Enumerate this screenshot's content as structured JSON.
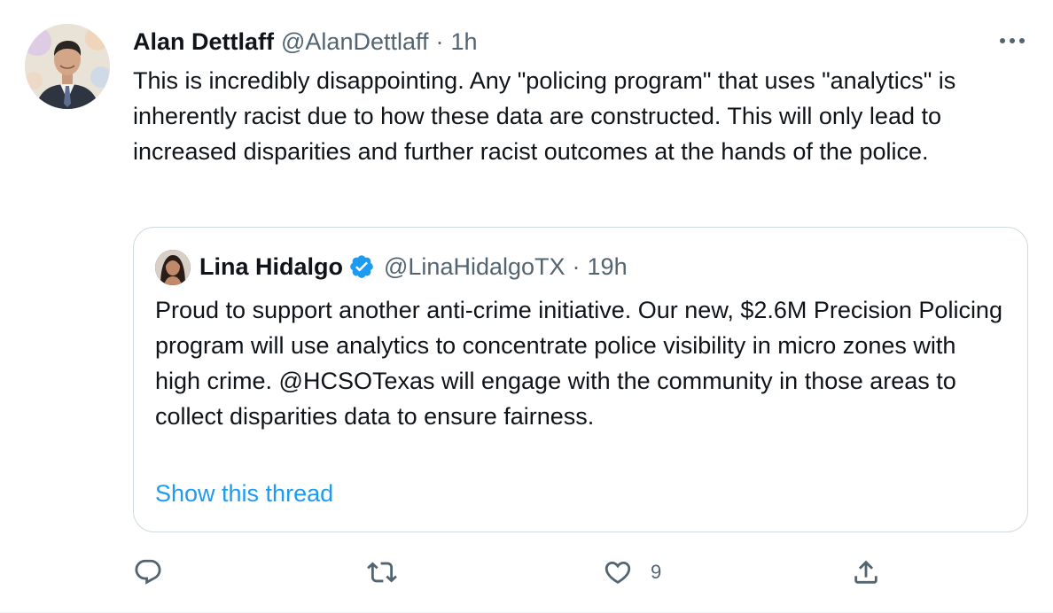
{
  "tweet": {
    "author_name": "Alan Dettlaff",
    "author_handle": "@AlanDettlaff",
    "separator": "·",
    "time": "1h",
    "text": "This is incredibly disappointing. Any \"policing program\" that uses \"analytics\" is inherently racist due to how these data are constructed. This will only lead to increased disparities and further racist outcomes at the hands of the police."
  },
  "quote": {
    "author_name": "Lina Hidalgo",
    "author_handle": "@LinaHidalgoTX",
    "separator": "·",
    "time": "19h",
    "verified": true,
    "text": "Proud to support another anti-crime initiative. Our new, $2.6M Precision Policing program will use analytics to concentrate police visibility in micro zones with high crime. @HCSOTexas will engage with the community in those areas to collect disparities data to ensure fairness.",
    "show_thread": "Show this thread"
  },
  "actions": {
    "reply_count": "",
    "retweet_count": "",
    "like_count": "9",
    "share_count": ""
  },
  "icons": {
    "more": "more-icon",
    "reply": "reply-icon",
    "retweet": "retweet-icon",
    "like": "heart-icon",
    "share": "share-icon",
    "verified": "verified-badge-icon"
  },
  "colors": {
    "text": "#0f1419",
    "muted": "#536471",
    "accent": "#1d9bf0",
    "border": "#cfd9de"
  }
}
